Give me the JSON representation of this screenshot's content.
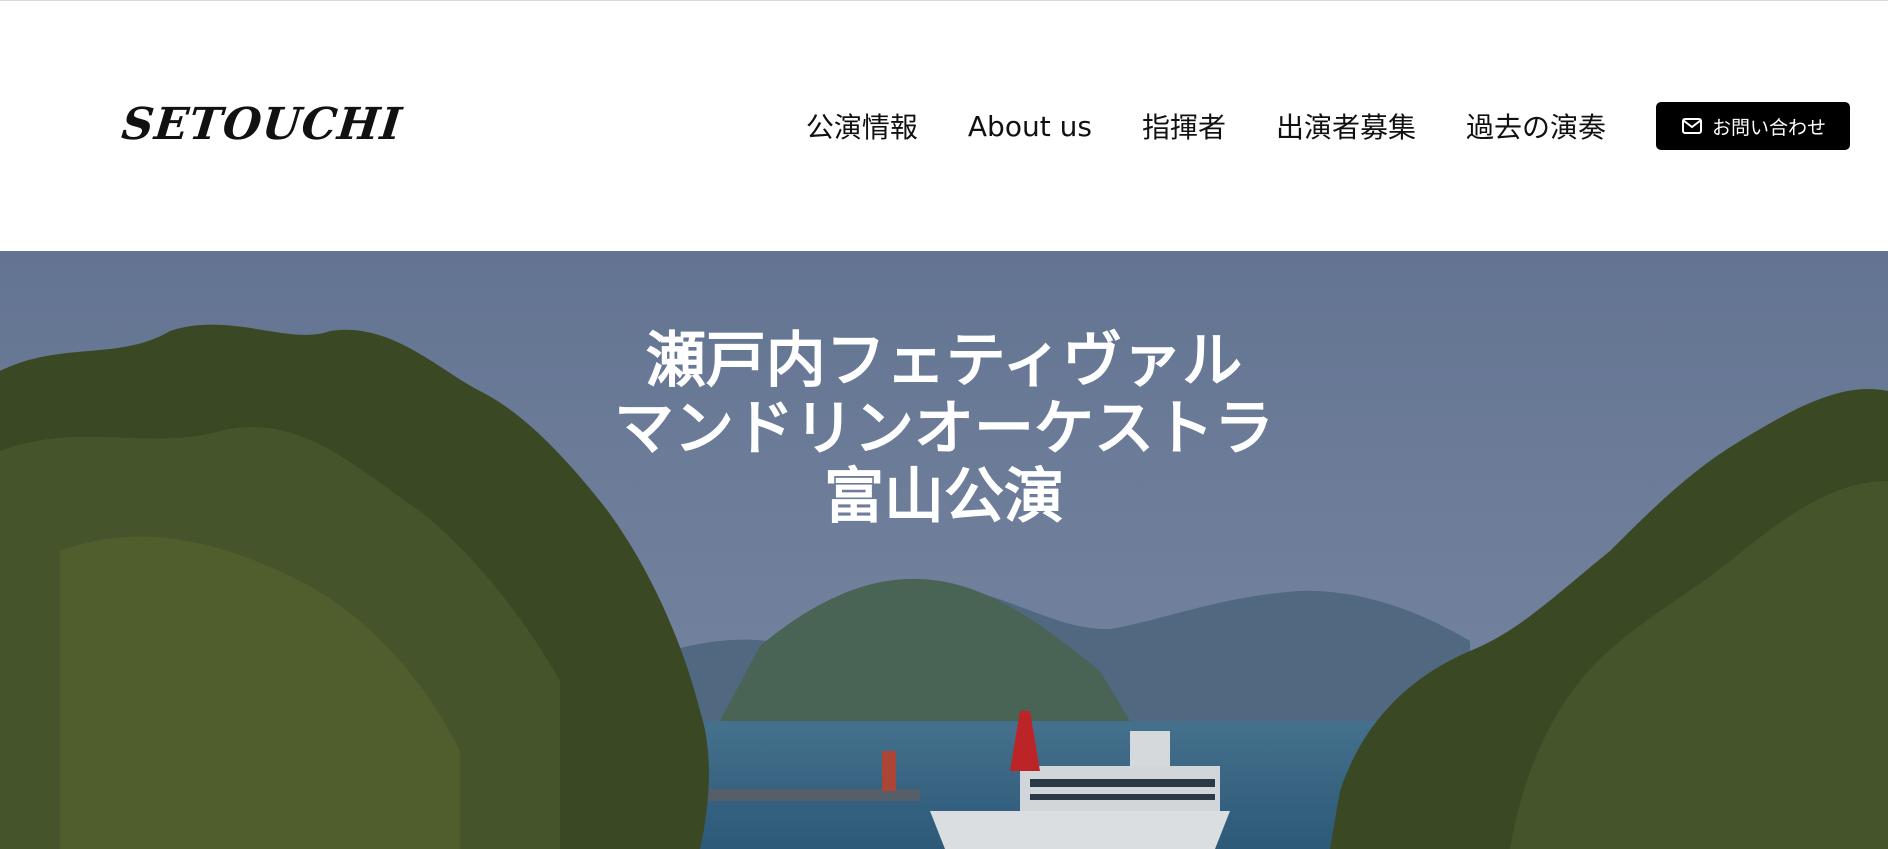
{
  "brand": {
    "logo_text": "SETOUCHI"
  },
  "nav": {
    "items": [
      {
        "label": "公演情報"
      },
      {
        "label": "About us"
      },
      {
        "label": "指揮者"
      },
      {
        "label": "出演者募集"
      },
      {
        "label": "過去の演奏"
      }
    ],
    "contact": {
      "label": "お問い合わせ",
      "icon": "mail-icon"
    }
  },
  "hero": {
    "title_lines": [
      "瀬戸内フェティヴァル",
      "マンドリンオーケストラ",
      "富山公演"
    ]
  },
  "colors": {
    "sky": "#6e7f9e",
    "sea": "#3d6c8a",
    "pine": "#3f4f25",
    "button_bg": "#000000"
  }
}
